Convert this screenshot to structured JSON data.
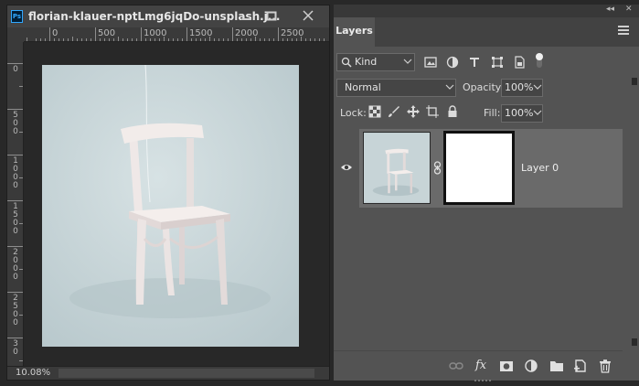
{
  "document": {
    "title": "florian-klauer-nptLmg6jqDo-unsplash.j...",
    "ps_badge": "Ps",
    "zoom": "10.08%",
    "ruler_h_labels": [
      "0",
      "500",
      "1000",
      "1500",
      "2000",
      "2500"
    ],
    "ruler_v_labels": [
      "0",
      "5 0 0",
      "1 0 0 0",
      "1 5 0 0",
      "2 0 0 0",
      "2 5 0 0",
      "3 0"
    ]
  },
  "panel": {
    "tab": "Layers",
    "filter_kind": "Kind",
    "blend_mode": "Normal",
    "opacity_label": "Opacity:",
    "opacity": "100%",
    "lock_label": "Lock:",
    "fill_label": "Fill:",
    "fill": "100%",
    "layers": [
      {
        "name": "Layer 0",
        "visible": true,
        "has_mask": true
      }
    ]
  },
  "colors": {
    "panel_bg": "#535353",
    "selected_row": "#6a6a6a",
    "photo_bg": "#c9d6d9",
    "ps_blue": "#31a8ff"
  }
}
